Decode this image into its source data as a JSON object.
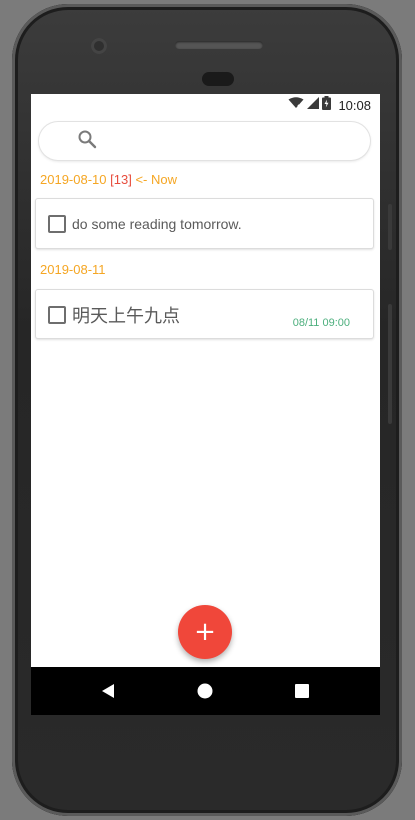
{
  "status_bar": {
    "time": "10:08",
    "icons": [
      "wifi-off-icon",
      "signal-icon",
      "battery-charging-icon"
    ]
  },
  "search": {
    "placeholder": "",
    "value": "",
    "icon": "search-icon"
  },
  "groups": [
    {
      "date": "2019-08-10",
      "count": "[13]",
      "now_label": "<- Now",
      "tasks": [
        {
          "text": "do some reading tomorrow.",
          "checked": false,
          "time": ""
        }
      ]
    },
    {
      "date": "2019-08-11",
      "tasks": [
        {
          "text": "明天上午九点",
          "checked": false,
          "time": "08/11 09:00"
        }
      ]
    }
  ],
  "fab": {
    "label": "+"
  },
  "colors": {
    "date_header": "#f5a623",
    "count": "#e74c3c",
    "task_time": "#4caf7d",
    "fab": "#f0473a"
  },
  "nav_bar": {
    "icons": [
      "back-icon",
      "home-icon",
      "recents-icon"
    ]
  }
}
